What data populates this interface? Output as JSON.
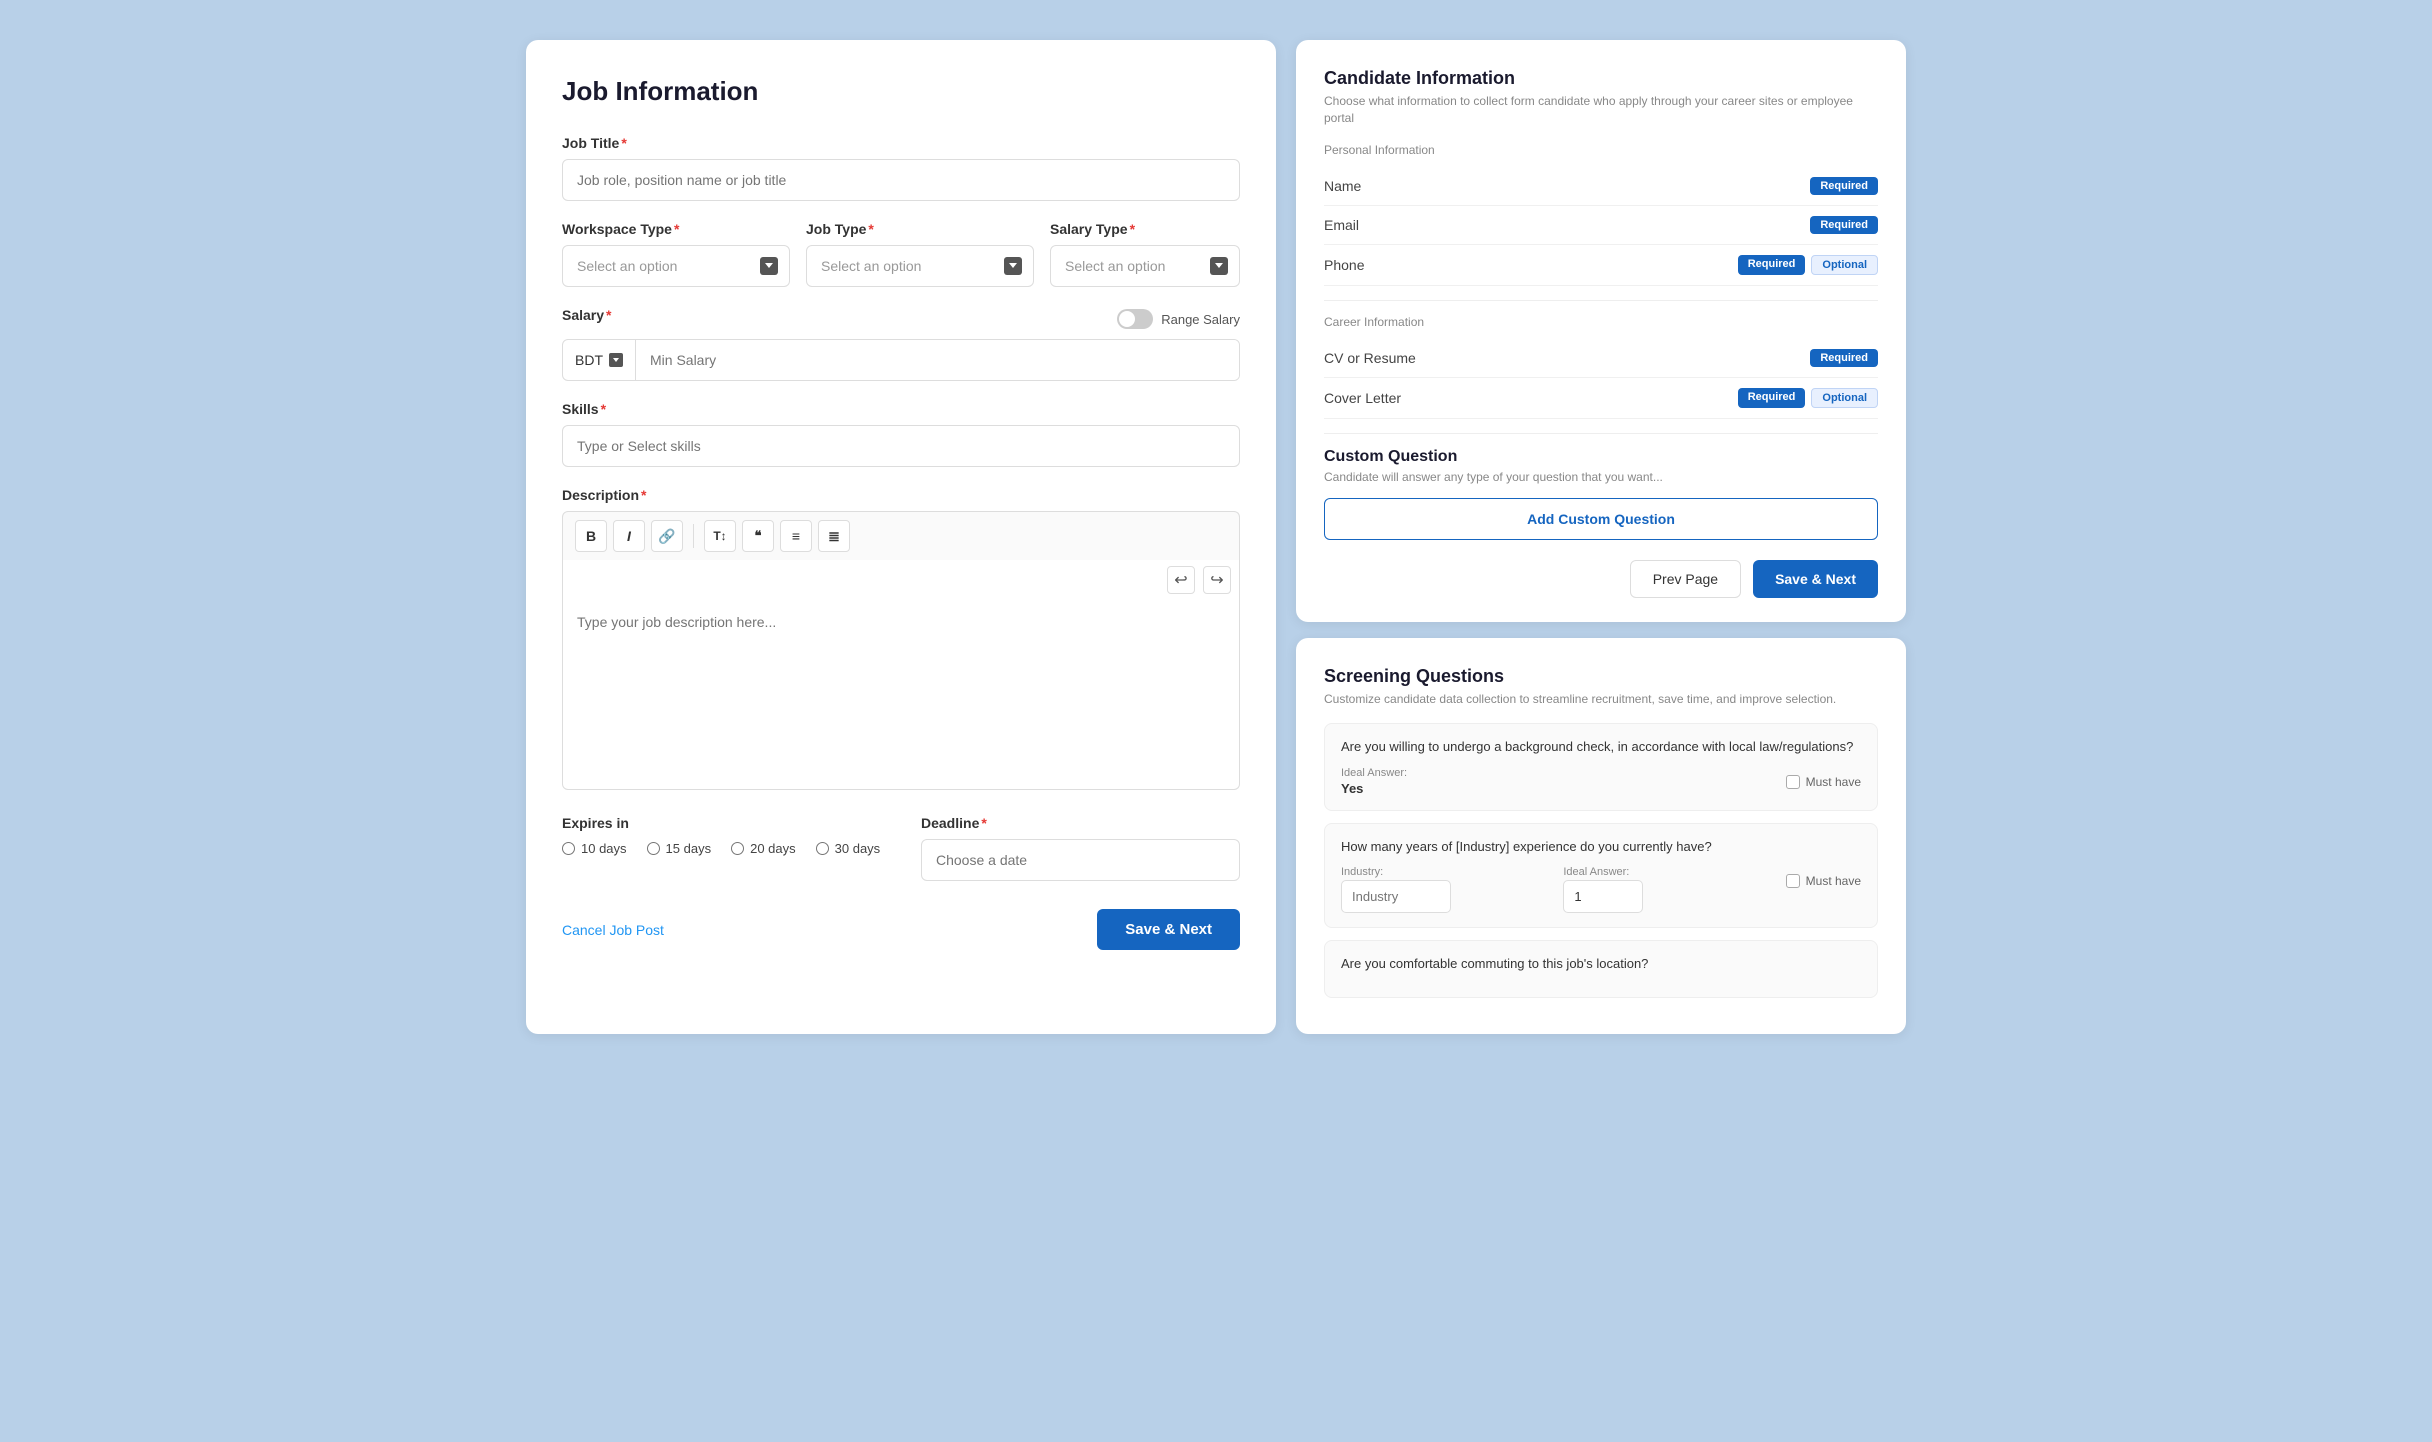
{
  "left": {
    "title": "Job Information",
    "jobTitle": {
      "label": "Job Title",
      "placeholder": "Job role, position name or job title"
    },
    "workspaceType": {
      "label": "Workspace Type",
      "placeholder": "Select an option"
    },
    "jobType": {
      "label": "Job Type",
      "placeholder": "Select an option"
    },
    "salaryType": {
      "label": "Salary Type",
      "placeholder": "Select an option"
    },
    "salary": {
      "label": "Salary",
      "currency": "BDT",
      "placeholder": "Min Salary",
      "toggleLabel": "Range Salary"
    },
    "skills": {
      "label": "Skills",
      "placeholder": "Type or Select skills"
    },
    "description": {
      "label": "Description",
      "placeholder": "Type your job description here...",
      "toolbar": {
        "bold": "B",
        "italic": "I",
        "link": "🔗",
        "heading": "T↕",
        "quote": "❝",
        "unordered": "≡",
        "ordered": "≣"
      }
    },
    "expiresIn": {
      "label": "Expires in",
      "options": [
        "10 days",
        "15 days",
        "20 days",
        "30 days"
      ]
    },
    "deadline": {
      "label": "Deadline",
      "placeholder": "Choose a date"
    },
    "cancelLabel": "Cancel Job Post",
    "saveNextLabel": "Save & Next"
  },
  "candidateInfo": {
    "title": "Candidate Information",
    "subtitle": "Choose what information to collect form candidate who apply through your career sites or employee portal",
    "personalInfo": {
      "label": "Personal Information",
      "fields": [
        {
          "name": "Name",
          "badges": [
            "Required"
          ]
        },
        {
          "name": "Email",
          "badges": [
            "Required"
          ]
        },
        {
          "name": "Phone",
          "badges": [
            "Required",
            "Optional"
          ]
        }
      ]
    },
    "careerInfo": {
      "label": "Career Information",
      "fields": [
        {
          "name": "CV or Resume",
          "badges": [
            "Required"
          ]
        },
        {
          "name": "Cover Letter",
          "badges": [
            "Required",
            "Optional"
          ]
        }
      ]
    },
    "customQuestion": {
      "title": "Custom Question",
      "subtitle": "Candidate will answer any type of your question that you want...",
      "addButtonLabel": "Add Custom Question"
    },
    "footer": {
      "prevLabel": "Prev Page",
      "nextLabel": "Save & Next"
    }
  },
  "screeningQuestions": {
    "title": "Screening Questions",
    "subtitle": "Customize candidate data collection to streamline recruitment, save time, and improve selection.",
    "questions": [
      {
        "text": "Are you willing to undergo a background check, in accordance with local law/regulations?",
        "idealAnswerLabel": "Ideal Answer:",
        "idealAnswer": "Yes",
        "mustHave": "Must have"
      },
      {
        "text": "How many years of [Industry] experience do you currently have?",
        "industryLabel": "Industry:",
        "industryPlaceholder": "Industry",
        "idealAnswerLabel": "Ideal Answer:",
        "idealAnswer": "1",
        "mustHave": "Must have"
      },
      {
        "text": "Are you comfortable commuting to this job's location?"
      }
    ]
  }
}
